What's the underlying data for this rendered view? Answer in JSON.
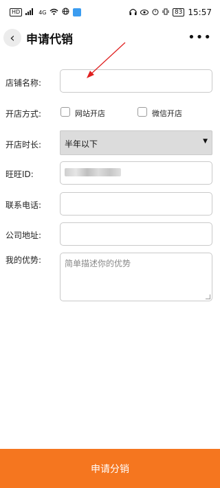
{
  "status_bar": {
    "left_chips": [
      "HD",
      "4G"
    ],
    "battery": "83",
    "time": "15:57"
  },
  "header": {
    "back_icon": "‹",
    "title": "申请代销",
    "more_icon": "•••"
  },
  "form": {
    "shop_name": {
      "label": "店铺名称:",
      "value": ""
    },
    "open_method": {
      "label": "开店方式:",
      "options": [
        {
          "label": "网站开店",
          "checked": false
        },
        {
          "label": "微信开店",
          "checked": false
        }
      ]
    },
    "open_duration": {
      "label": "开店时长:",
      "selected": "半年以下",
      "caret": "▼"
    },
    "wangwang_id": {
      "label": "旺旺ID:"
    },
    "phone": {
      "label": "联系电话:",
      "value": ""
    },
    "address": {
      "label": "公司地址:",
      "value": ""
    },
    "advantage": {
      "label": "我的优势:",
      "placeholder": "简单描述你的优势"
    }
  },
  "submit": {
    "label": "申请分销",
    "color": "#f5761f"
  },
  "annotation": {
    "arrow_color": "#e02020"
  }
}
